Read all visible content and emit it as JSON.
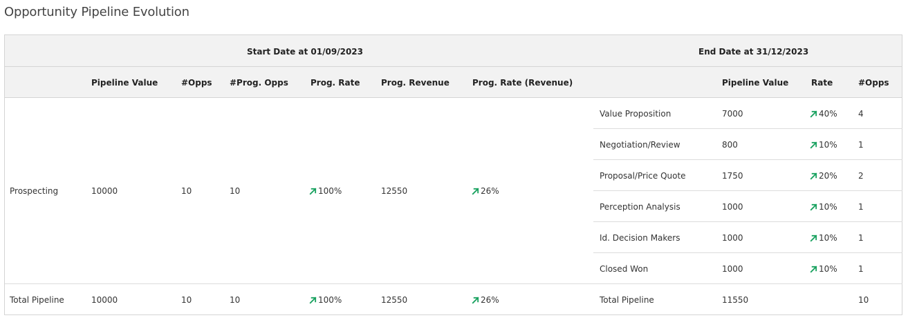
{
  "title": "Opportunity Pipeline Evolution",
  "group_headers": {
    "start": "Start Date at 01/09/2023",
    "end": "End Date at 31/12/2023"
  },
  "columns": {
    "pipeline_value": "Pipeline Value",
    "opps": "#Opps",
    "prog_opps": "#Prog. Opps",
    "prog_rate": "Prog. Rate",
    "prog_revenue": "Prog. Revenue",
    "prog_rate_revenue": "Prog. Rate (Revenue)",
    "end_pipeline_value": "Pipeline Value",
    "end_rate": "Rate",
    "end_opps": "#Opps"
  },
  "start_row": {
    "stage": "Prospecting",
    "pipeline_value": "10000",
    "opps": "10",
    "prog_opps": "10",
    "prog_rate": "100%",
    "prog_revenue": "12550",
    "prog_rate_revenue": "26%"
  },
  "end_rows": [
    {
      "stage": "Value Proposition",
      "pipeline_value": "7000",
      "rate": "40%",
      "opps": "4"
    },
    {
      "stage": "Negotiation/Review",
      "pipeline_value": "800",
      "rate": "10%",
      "opps": "1"
    },
    {
      "stage": "Proposal/Price Quote",
      "pipeline_value": "1750",
      "rate": "20%",
      "opps": "2"
    },
    {
      "stage": "Perception Analysis",
      "pipeline_value": "1000",
      "rate": "10%",
      "opps": "1"
    },
    {
      "stage": "Id. Decision Makers",
      "pipeline_value": "1000",
      "rate": "10%",
      "opps": "1"
    },
    {
      "stage": "Closed Won",
      "pipeline_value": "1000",
      "rate": "10%",
      "opps": "1"
    }
  ],
  "total_row": {
    "label": "Total Pipeline",
    "pipeline_value": "10000",
    "opps": "10",
    "prog_opps": "10",
    "prog_rate": "100%",
    "prog_revenue": "12550",
    "prog_rate_revenue": "26%",
    "end_label": "Total Pipeline",
    "end_pipeline_value": "11550",
    "end_opps": "10"
  },
  "colors": {
    "trend_up": "#1aa260",
    "header_bg": "#f2f2f2",
    "border": "#d4d4d4"
  },
  "icons": {
    "trend": "arrow-up-right-icon"
  }
}
